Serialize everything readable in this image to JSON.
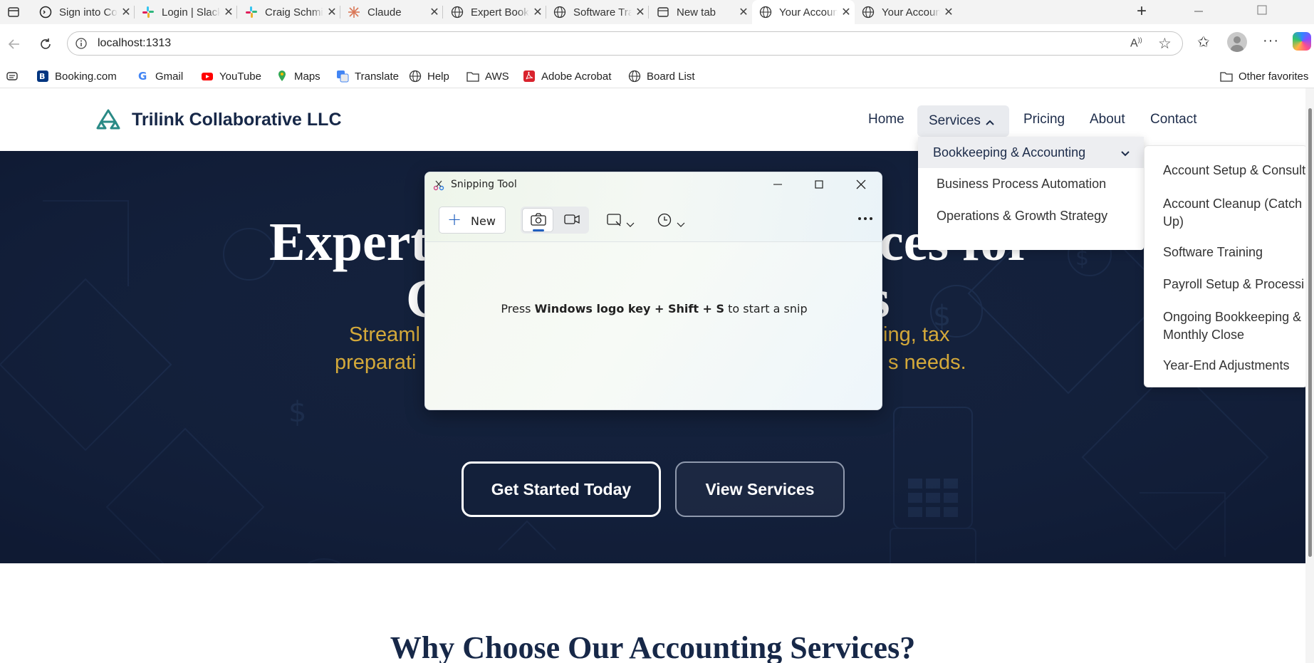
{
  "browser": {
    "tabs": [
      {
        "title": "Sign into Code",
        "icon": "terminal-icon"
      },
      {
        "title": "Login | Slack",
        "icon": "slack-icon"
      },
      {
        "title": "Craig Schmied",
        "icon": "slack-icon"
      },
      {
        "title": "Claude",
        "icon": "claude-icon"
      },
      {
        "title": "Expert Bookke",
        "icon": "globe-icon"
      },
      {
        "title": "Software Train",
        "icon": "globe-icon"
      },
      {
        "title": "New tab",
        "icon": "newtab-icon"
      },
      {
        "title": "Your Accounti",
        "icon": "globe-icon"
      },
      {
        "title": "Your Accounti",
        "icon": "globe-icon"
      }
    ],
    "active_tab_index": 7,
    "url": "localhost:1313",
    "bookmarks": [
      {
        "label": "Booking.com",
        "icon": "booking-icon"
      },
      {
        "label": "Gmail",
        "icon": "google-icon"
      },
      {
        "label": "YouTube",
        "icon": "youtube-icon"
      },
      {
        "label": "Maps",
        "icon": "maps-icon"
      },
      {
        "label": "Translate",
        "icon": "translate-icon"
      },
      {
        "label": "Help",
        "icon": "globe-icon"
      },
      {
        "label": "AWS",
        "icon": "folder-icon"
      },
      {
        "label": "Adobe Acrobat",
        "icon": "acrobat-icon"
      },
      {
        "label": "Board List",
        "icon": "globe-icon"
      }
    ],
    "other_favorites": "Other favorites"
  },
  "site": {
    "brand": "Trilink Collaborative LLC",
    "nav": {
      "home": "Home",
      "services": "Services",
      "pricing": "Pricing",
      "about": "About",
      "contact": "Contact"
    },
    "services_menu": [
      "Bookkeeping & Accounting",
      "Business Process Automation",
      "Operations & Growth Strategy"
    ],
    "bookkeeping_submenu": [
      "Account Setup & Consult",
      "Account Cleanup (Catch Up)",
      "Software Training",
      "Payroll Setup & Processi",
      "Ongoing Bookkeeping & Monthly Close",
      "Year-End Adjustments"
    ],
    "hero": {
      "title_line1_left": "Expert",
      "title_line1_right": "ces for",
      "title_line2_left": "C",
      "title_line2_right": "s",
      "subtitle_line1_left": "Streaml",
      "subtitle_line1_right": "ing, tax",
      "subtitle_line2_left": "preparati",
      "subtitle_line2_right": "s needs.",
      "cta_primary": "Get Started Today",
      "cta_secondary": "View Services"
    },
    "section_heading": "Why Choose Our Accounting Services?"
  },
  "snipping_tool": {
    "title": "Snipping Tool",
    "new_label": "New",
    "hint_prefix": "Press ",
    "hint_keys": "Windows logo key + Shift + S",
    "hint_suffix": " to start a snip"
  },
  "colors": {
    "hero_bg": "#13203a",
    "accent_gold": "#d4a93a",
    "brand_teal": "#2a8a86",
    "nav_text": "#1d2c4a"
  }
}
